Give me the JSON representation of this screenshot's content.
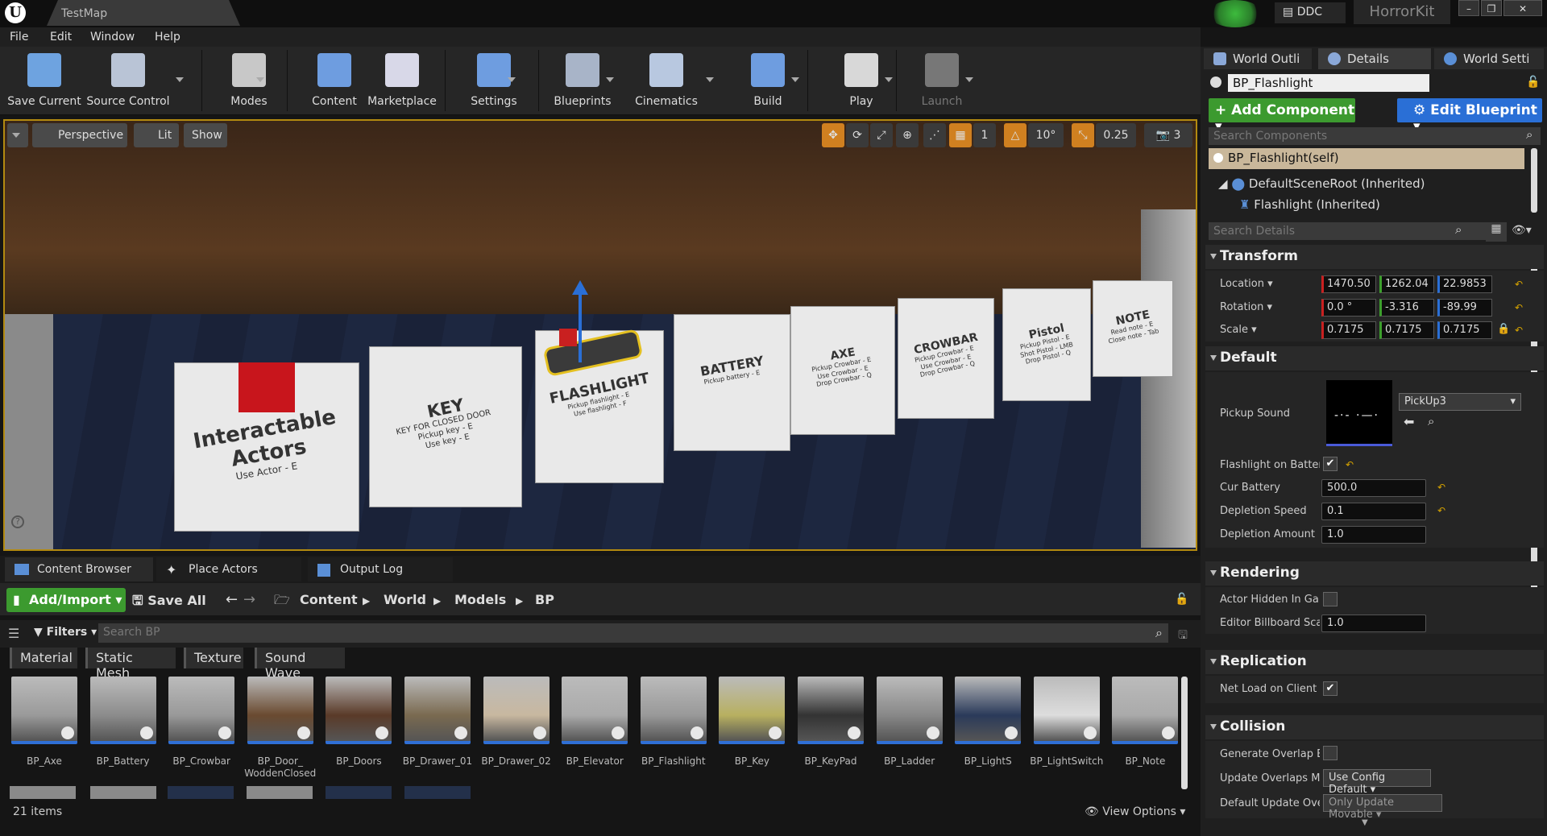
{
  "window": {
    "map_tab": "TestMap",
    "ddc_label": "DDC",
    "project_name": "HorrorKit",
    "controls": [
      "–",
      "❐",
      "✕"
    ]
  },
  "menu": [
    "File",
    "Edit",
    "Window",
    "Help"
  ],
  "toolbar": [
    {
      "label": "Save Current",
      "icon": "save-disk-icon",
      "color": "#6ea3e0"
    },
    {
      "label": "Source Control",
      "icon": "source-control-icon",
      "color": "#b9c4d6"
    },
    {
      "label": "Modes",
      "icon": "modes-tools-icon",
      "color": "#c8c8c8"
    },
    {
      "label": "Content",
      "icon": "content-grid-icon",
      "color": "#6e9de0"
    },
    {
      "label": "Marketplace",
      "icon": "marketplace-bag-icon",
      "color": "#d8d8e8"
    },
    {
      "label": "Settings",
      "icon": "settings-gear-icon",
      "color": "#6e9de0"
    },
    {
      "label": "Blueprints",
      "icon": "blueprints-gamepad-icon",
      "color": "#a8b4c8"
    },
    {
      "label": "Cinematics",
      "icon": "cinematics-clapper-icon",
      "color": "#b8c8e0"
    },
    {
      "label": "Build",
      "icon": "build-cubes-icon",
      "color": "#6e9de0"
    },
    {
      "label": "Play",
      "icon": "play-triangle-icon",
      "color": "#d8d8d8"
    },
    {
      "label": "Launch",
      "icon": "launch-device-icon",
      "color": "#777777"
    }
  ],
  "viewport": {
    "perspective": "Perspective",
    "lit": "Lit",
    "show": "Show",
    "grid_snap": "1",
    "rotation_snap": "10°",
    "scale_snap": "0.25",
    "camera_speed": "3",
    "boxes": [
      {
        "title": "Interactable Actors",
        "sub": "Use Actor - E"
      },
      {
        "title": "KEY",
        "sub": "KEY FOR CLOSED DOOR\nPickup key - E\nUse key - E"
      },
      {
        "title": "FLASHLIGHT",
        "sub": "Pickup flashlight - E\nUse flashlight - F"
      },
      {
        "title": "BATTERY",
        "sub": "Pickup battery - E"
      },
      {
        "title": "AXE",
        "sub": "Pickup Crowbar - E\nUse Crowbar - E\nDrop Crowbar - Q"
      },
      {
        "title": "CROWBAR",
        "sub": "Pickup Crowbar - E\nUse Crowbar - E\nDrop Crowbar - Q"
      },
      {
        "title": "Pistol",
        "sub": "Pickup Pistol - E\nShot Pistol - LMB\nDrop Pistol - Q"
      },
      {
        "title": "NOTE",
        "sub": "Read note - E\nClose note - Tab"
      }
    ]
  },
  "content_browser": {
    "tabs": [
      "Content Browser",
      "Place Actors",
      "Output Log"
    ],
    "add_import": "Add/Import",
    "save_all": "Save All",
    "breadcrumb": [
      "Content",
      "World",
      "Models",
      "BP"
    ],
    "filters": "Filters",
    "search_placeholder": "Search BP",
    "filter_tags": [
      "Material",
      "Static Mesh",
      "Texture",
      "Sound Wave"
    ],
    "assets": [
      "BP_Axe",
      "BP_Battery",
      "BP_Crowbar",
      "BP_Door_\nWoddenClosed",
      "BP_Doors",
      "BP_Drawer_01",
      "BP_Drawer_02",
      "BP_Elevator",
      "BP_Flashlight",
      "BP_Key",
      "BP_KeyPad",
      "BP_Ladder",
      "BP_LightS",
      "BP_LightSwitch",
      "BP_Note"
    ],
    "item_count": "21 items",
    "view_options": "View Options"
  },
  "right_panel": {
    "tabs": [
      "World Outli",
      "Details",
      "World Setti"
    ],
    "actor_name": "BP_Flashlight",
    "add_component": "Add Component",
    "edit_blueprint": "Edit Blueprint",
    "search_components": "Search Components",
    "components": {
      "self": "BP_Flashlight(self)",
      "root": "DefaultSceneRoot (Inherited)",
      "child": "Flashlight (Inherited)"
    },
    "search_details": "Search Details",
    "transform": {
      "title": "Transform",
      "location_label": "Location",
      "location": [
        "1470.50",
        "1262.04",
        "22.9853"
      ],
      "rotation_label": "Rotation",
      "rotation": [
        "0.0 °",
        "-3.316",
        "-89.99"
      ],
      "scale_label": "Scale",
      "scale": [
        "0.7175",
        "0.7175",
        "0.7175"
      ]
    },
    "default": {
      "title": "Default",
      "pickup_sound_label": "Pickup Sound",
      "pickup_sound_value": "PickUp3",
      "flashlight_on_label": "Flashlight on Battery",
      "flashlight_on": true,
      "cur_battery_label": "Cur Battery",
      "cur_battery": "500.0",
      "depletion_speed_label": "Depletion Speed",
      "depletion_speed": "0.1",
      "depletion_amount_label": "Depletion Amount",
      "depletion_amount": "1.0"
    },
    "rendering": {
      "title": "Rendering",
      "hidden_label": "Actor Hidden In Game",
      "hidden": false,
      "billboard_label": "Editor Billboard Scale",
      "billboard": "1.0"
    },
    "replication": {
      "title": "Replication",
      "net_load_label": "Net Load on Client",
      "net_load": true
    },
    "collision": {
      "title": "Collision",
      "gen_overlap_label": "Generate Overlap Events",
      "gen_overlap": false,
      "update_overlaps_label": "Update Overlaps Method",
      "update_overlaps": "Use Config Default",
      "default_update_label": "Default Update Overlaps",
      "default_update": "Only Update Movable"
    }
  }
}
